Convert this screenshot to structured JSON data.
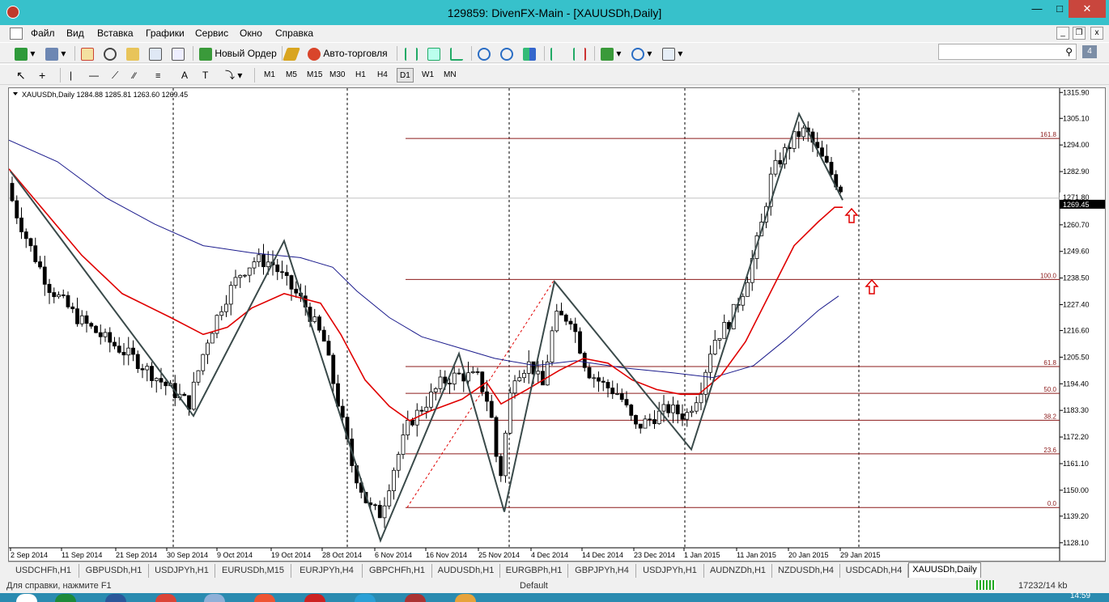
{
  "window": {
    "title": "129859: DivenFX-Main - [XAUUSDh,Daily]"
  },
  "menu": [
    "Файл",
    "Вид",
    "Вставка",
    "Графики",
    "Сервис",
    "Окно",
    "Справка"
  ],
  "toolbar": {
    "new_order": "Новый Ордер",
    "autotrading": "Авто-торговля"
  },
  "timeframes": [
    "M1",
    "M5",
    "M15",
    "M30",
    "H1",
    "H4",
    "D1",
    "W1",
    "MN"
  ],
  "active_timeframe": "D1",
  "search": {
    "value": ""
  },
  "notifications": {
    "count": "4"
  },
  "chart": {
    "header": "XAUUSDh,Daily  1284.88 1285.81 1263.60 1269.45",
    "symbol": "XAUUSDh,Daily",
    "ohlc": "1284.88 1285.81 1263.60 1269.45",
    "current_price": "1269.45",
    "current_price_value": 1269.45,
    "secondary_label": "1271.80",
    "price_axis": [
      "1315.90",
      "1305.10",
      "1294.00",
      "1282.90",
      "1271.80",
      "1260.70",
      "1249.60",
      "1238.50",
      "1227.40",
      "1216.60",
      "1205.50",
      "1194.40",
      "1183.30",
      "1172.20",
      "1161.10",
      "1150.00",
      "1139.20",
      "1128.10"
    ],
    "date_axis": [
      "2 Sep 2014",
      "11 Sep 2014",
      "21 Sep 2014",
      "30 Sep 2014",
      "9 Oct 2014",
      "19 Oct 2014",
      "28 Oct 2014",
      "6 Nov 2014",
      "16 Nov 2014",
      "25 Nov 2014",
      "4 Dec 2014",
      "14 Dec 2014",
      "23 Dec 2014",
      "1 Jan 2015",
      "11 Jan 2015",
      "20 Jan 2015",
      "29 Jan 2015"
    ],
    "fib_levels": [
      {
        "label": "161.8",
        "price": 1296.7
      },
      {
        "label": "100.0",
        "price": 1237.9
      },
      {
        "label": "61.8",
        "price": 1201.6
      },
      {
        "label": "50.0",
        "price": 1190.4
      },
      {
        "label": "38.2",
        "price": 1179.2
      },
      {
        "label": "23.6",
        "price": 1165.2
      },
      {
        "label": "0.0",
        "price": 1142.8
      }
    ],
    "colors": {
      "bull": "#ffffff",
      "bear": "#000000",
      "ma_fast": "#e00000",
      "ma_slow": "#1a1a8c",
      "zigzag": "#3a4a4a",
      "fib": "#8b1a1a",
      "arrow": "#e00000"
    }
  },
  "tabs": [
    "USDCHFh,H1",
    "GBPUSDh,H1",
    "USDJPYh,H1",
    "EURUSDh,M15",
    "EURJPYh,H4",
    "GBPCHFh,H1",
    "AUDUSDh,H1",
    "EURGBPh,H1",
    "GBPJPYh,H4",
    "USDJPYh,H1",
    "AUDNZDh,H1",
    "NZDUSDh,H4",
    "USDCADh,H4",
    "XAUUSDh,Daily"
  ],
  "active_tab": "XAUUSDh,Daily",
  "status": {
    "help": "Для справки, нажмите F1",
    "profile": "Default",
    "traffic": "17232/14 kb"
  },
  "taskbar": {
    "clock": "14:59"
  }
}
